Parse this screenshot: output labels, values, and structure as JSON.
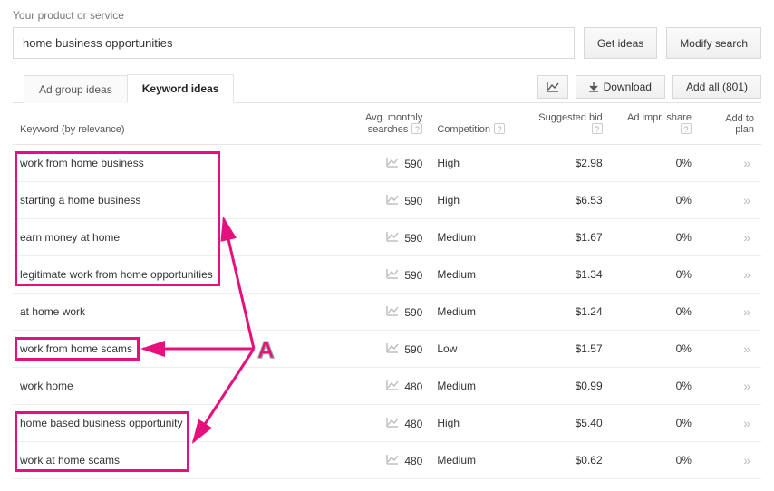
{
  "header": {
    "label": "Your product or service",
    "input_value": "home business opportunities",
    "get_ideas": "Get ideas",
    "modify_search": "Modify search"
  },
  "tabs": {
    "ad_group": "Ad group ideas",
    "keyword": "Keyword ideas"
  },
  "toolbar": {
    "download": "Download",
    "add_all": "Add all (801)"
  },
  "columns": {
    "keyword": "Keyword (by relevance)",
    "avg": "Avg. monthly searches",
    "competition": "Competition",
    "suggested_bid": "Suggested bid",
    "ad_impr": "Ad impr. share",
    "add_to_plan": "Add to plan"
  },
  "rows": [
    {
      "keyword": "work from home business",
      "avg": "590",
      "competition": "High",
      "bid": "$2.98",
      "impr": "0%"
    },
    {
      "keyword": "starting a home business",
      "avg": "590",
      "competition": "High",
      "bid": "$6.53",
      "impr": "0%"
    },
    {
      "keyword": "earn money at home",
      "avg": "590",
      "competition": "Medium",
      "bid": "$1.67",
      "impr": "0%"
    },
    {
      "keyword": "legitimate work from home opportunities",
      "avg": "590",
      "competition": "Medium",
      "bid": "$1.34",
      "impr": "0%"
    },
    {
      "keyword": "at home work",
      "avg": "590",
      "competition": "Medium",
      "bid": "$1.24",
      "impr": "0%"
    },
    {
      "keyword": "work from home scams",
      "avg": "590",
      "competition": "Low",
      "bid": "$1.57",
      "impr": "0%"
    },
    {
      "keyword": "work home",
      "avg": "480",
      "competition": "Medium",
      "bid": "$0.99",
      "impr": "0%"
    },
    {
      "keyword": "home based business opportunity",
      "avg": "480",
      "competition": "High",
      "bid": "$5.40",
      "impr": "0%"
    },
    {
      "keyword": "work at home scams",
      "avg": "480",
      "competition": "Medium",
      "bid": "$0.62",
      "impr": "0%"
    }
  ],
  "annotation": {
    "letter": "A"
  },
  "highlight_groups": [
    {
      "start": 0,
      "end": 3
    },
    {
      "start": 5,
      "end": 5
    },
    {
      "start": 7,
      "end": 8
    }
  ]
}
